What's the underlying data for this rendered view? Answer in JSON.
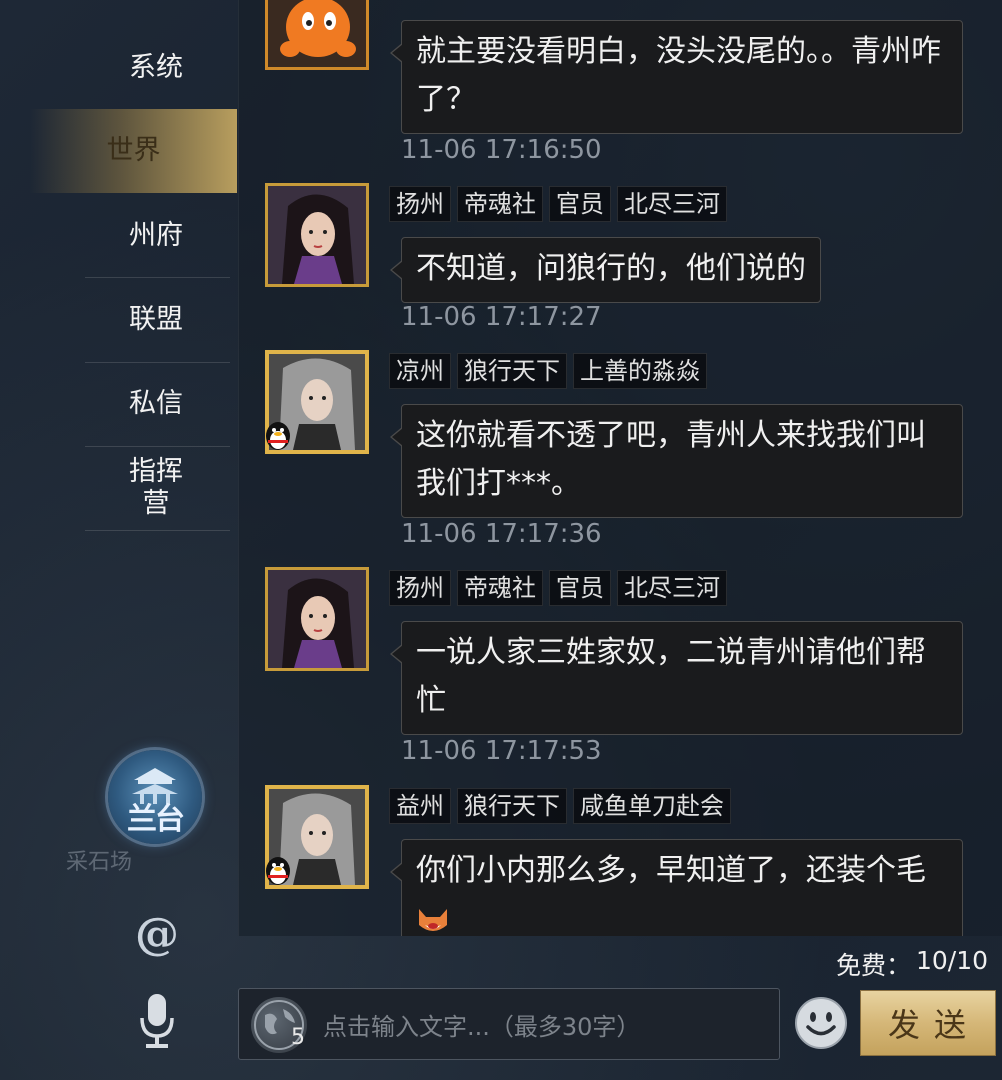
{
  "sidebar": {
    "tabs": [
      {
        "label": "系统"
      },
      {
        "label": "世界",
        "active": true
      },
      {
        "label": "州府"
      },
      {
        "label": "联盟"
      },
      {
        "label": "私信"
      },
      {
        "label": "指挥营"
      }
    ],
    "hall_label": "兰台",
    "map_label": "采石场",
    "at_icon": "@"
  },
  "chat": {
    "messages": [
      {
        "avatar": "orange-mascot",
        "tags": [],
        "text": "就主要没看明白，没头没尾的。。青州咋了？",
        "time": "11-06 17:16:50"
      },
      {
        "avatar": "female-general",
        "tags": [
          "扬州",
          "帝魂社",
          "官员",
          "北尽三河"
        ],
        "text": "不知道，问狼行的，他们说的",
        "time": "11-06 17:17:27"
      },
      {
        "avatar": "male-general",
        "qq": true,
        "tags": [
          "凉州",
          "狼行天下",
          "上善的淼焱"
        ],
        "text": "这你就看不透了吧，青州人来找我们叫我们打***。",
        "time": "11-06 17:17:36"
      },
      {
        "avatar": "female-general",
        "tags": [
          "扬州",
          "帝魂社",
          "官员",
          "北尽三河"
        ],
        "text": "一说人家三姓家奴，二说青州请他们帮忙",
        "time": "11-06 17:17:53"
      },
      {
        "avatar": "male-general",
        "qq": true,
        "tags": [
          "益州",
          "狼行天下",
          "咸鱼单刀赴会"
        ],
        "text": "你们小内那么多，早知道了，还装个毛",
        "time": ""
      }
    ]
  },
  "footer": {
    "quota_label": "免费：",
    "quota_value": "10/10",
    "input_placeholder": "点击输入文字...（最多30字）",
    "counter": "5",
    "send_label": "发送"
  },
  "colors": {
    "background": "#1b2533",
    "gold": "#c79b3a",
    "send": "#d5b778",
    "bubble": "#1a1b1d"
  }
}
